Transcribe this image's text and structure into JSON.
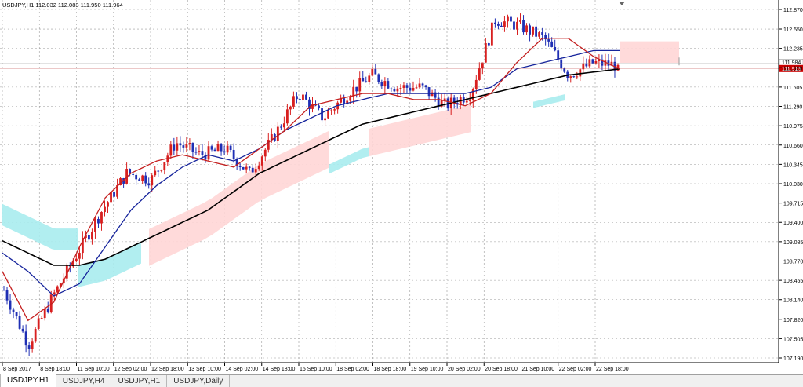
{
  "window": {
    "header": "USDJPY,H1  112.032 112.083 111.950 111.964"
  },
  "colors": {
    "bull_candle": "#d81f1f",
    "bear_candle": "#1f2fb4",
    "ma_fast": "#c41e1e",
    "ma_mid": "#16249c",
    "ma_slow": "#000000",
    "cloud_bull": "#ffd6d6",
    "cloud_bear": "#a9ecee",
    "grid": "#9a9a9a",
    "ask_line": "#8c8c8c",
    "bid_line": "#b22222",
    "bid_label_bg": "#cc0000"
  },
  "chart_data": {
    "type": "candlestick",
    "symbol": "USDJPY",
    "timeframe": "H1",
    "ylim": [
      107.19,
      112.87
    ],
    "y_ticks": [
      "112.870",
      "112.550",
      "112.235",
      "111.920",
      "111.605",
      "111.290",
      "110.975",
      "110.660",
      "110.345",
      "110.030",
      "109.715",
      "109.400",
      "109.085",
      "108.770",
      "108.455",
      "108.140",
      "107.820",
      "107.505",
      "107.190"
    ],
    "x_ticks": [
      "8 Sep 2017",
      "8 Sep 18:00",
      "11 Sep 10:00",
      "12 Sep 02:00",
      "12 Sep 18:00",
      "13 Sep 10:00",
      "14 Sep 02:00",
      "14 Sep 18:00",
      "15 Sep 10:00",
      "18 Sep 02:00",
      "18 Sep 18:00",
      "19 Sep 10:00",
      "20 Sep 02:00",
      "20 Sep 18:00",
      "21 Sep 10:00",
      "22 Sep 02:00",
      "22 Sep 18:00"
    ],
    "ask_price": "111.984",
    "bid_price": "111.913",
    "price_path": [
      108.3,
      107.4,
      108.2,
      108.9,
      109.6,
      110.2,
      110.1,
      110.7,
      110.5,
      110.6,
      110.2,
      110.8,
      111.5,
      111.1,
      111.5,
      111.8,
      111.6,
      111.6,
      111.3,
      111.5,
      112.7,
      112.6,
      112.4,
      111.8,
      112.0,
      111.96
    ],
    "ma_fast": [
      108.6,
      107.8,
      108.1,
      109.0,
      109.8,
      110.2,
      110.4,
      110.5,
      110.4,
      110.3,
      110.6,
      110.9,
      111.3,
      111.4,
      111.5,
      111.5,
      111.4,
      111.4,
      111.3,
      111.5,
      112.0,
      112.4,
      112.4,
      112.1,
      111.9
    ],
    "ma_mid": [
      108.9,
      108.6,
      108.2,
      108.4,
      109.0,
      109.6,
      110.0,
      110.3,
      110.5,
      110.4,
      110.6,
      110.9,
      111.1,
      111.3,
      111.4,
      111.5,
      111.5,
      111.5,
      111.5,
      111.6,
      111.9,
      112.0,
      112.1,
      112.2,
      112.2
    ],
    "ma_slow": [
      109.1,
      108.9,
      108.7,
      108.7,
      108.8,
      109.0,
      109.2,
      109.4,
      109.6,
      109.9,
      110.2,
      110.4,
      110.6,
      110.8,
      111.0,
      111.1,
      111.2,
      111.3,
      111.4,
      111.5,
      111.6,
      111.7,
      111.8,
      111.85,
      111.9
    ]
  },
  "tabs": [
    {
      "label": "USDJPY,H1",
      "active": true
    },
    {
      "label": "USDJPY,H4",
      "active": false
    },
    {
      "label": "USDJPY,H1",
      "active": false
    },
    {
      "label": "USDJPY,Daily",
      "active": false
    }
  ]
}
